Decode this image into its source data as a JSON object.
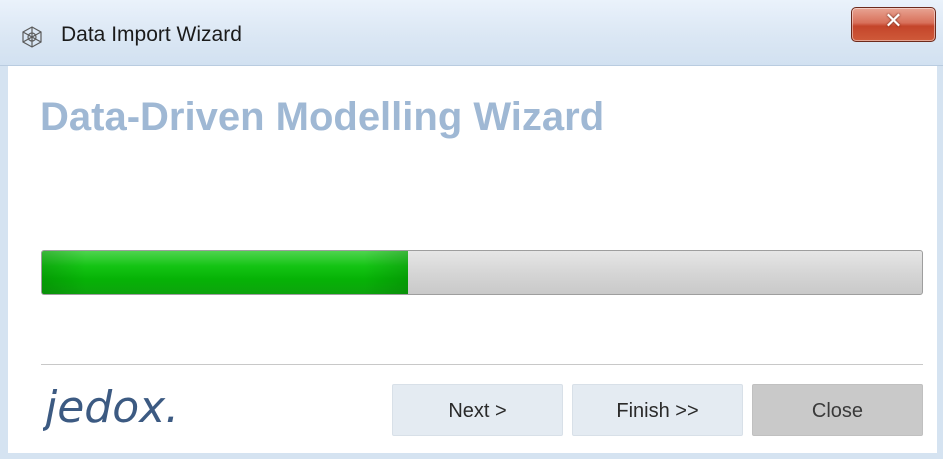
{
  "window": {
    "title": "Data Import Wizard",
    "title_icon": "wizard-cube-icon",
    "close_glyph": "✕"
  },
  "main": {
    "heading": "Data-Driven Modelling Wizard",
    "progress_fraction": 0.416
  },
  "footer": {
    "logo_text": "jedox.",
    "buttons": {
      "next_label": "Next >",
      "finish_label": "Finish >>",
      "close_label": "Close"
    }
  },
  "colors": {
    "heading": "#9fb8d4",
    "progress_fill": "#06b306",
    "logo": "#3c5a82"
  }
}
